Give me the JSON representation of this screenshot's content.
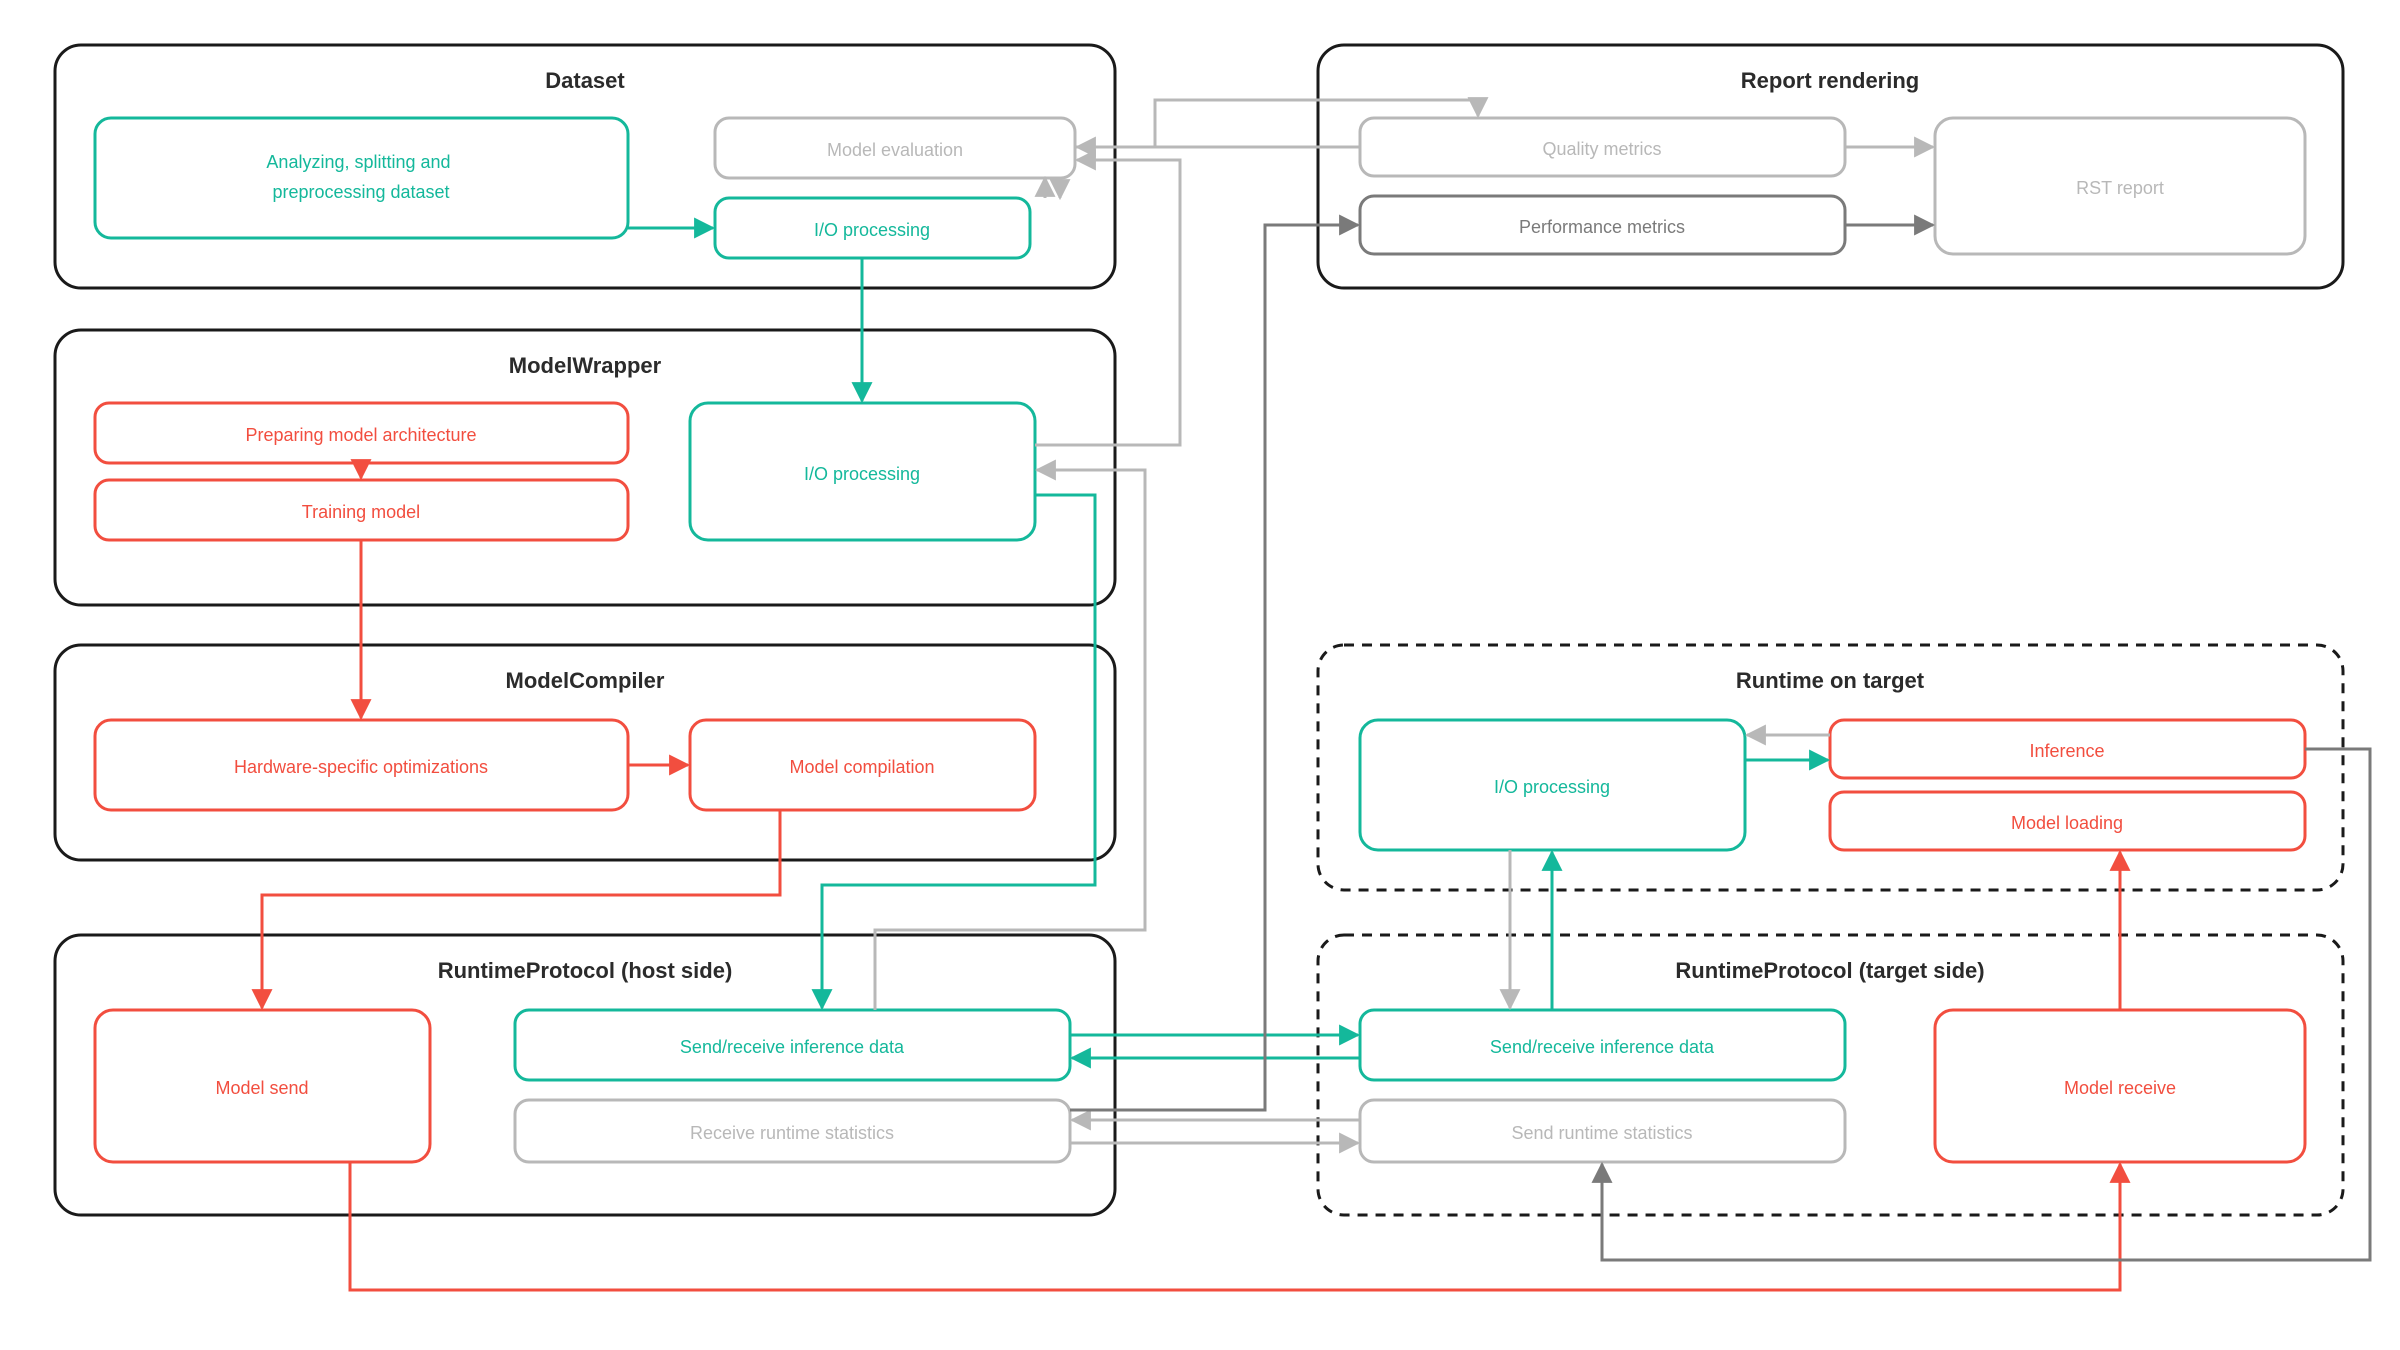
{
  "colors": {
    "black": "#1a1a1a",
    "teal": "#14b89b",
    "red": "#f24e3f",
    "gray": "#b8b8b8",
    "darkgray": "#7a7a7a",
    "bg": "#ffffff"
  },
  "groups": {
    "dataset": {
      "title": "Dataset",
      "nodes": {
        "analyze": "Analyzing, splitting and\npreprocessing dataset",
        "model_eval": "Model evaluation",
        "io_processing": "I/O processing"
      }
    },
    "model_wrapper": {
      "title": "ModelWrapper",
      "nodes": {
        "prepare_arch": "Preparing model architecture",
        "training": "Training model",
        "io_processing": "I/O processing"
      }
    },
    "model_compiler": {
      "title": "ModelCompiler",
      "nodes": {
        "hw_opt": "Hardware-specific optimizations",
        "compilation": "Model compilation"
      }
    },
    "runtime_protocol_host": {
      "title": "RuntimeProtocol (host side)",
      "nodes": {
        "model_send": "Model send",
        "send_recv_inf": "Send/receive inference data",
        "recv_stats": "Receive runtime statistics"
      }
    },
    "report_rendering": {
      "title": "Report rendering",
      "nodes": {
        "quality": "Quality metrics",
        "performance": "Performance metrics",
        "rst_report": "RST report"
      }
    },
    "runtime_on_target": {
      "title": "Runtime on target",
      "nodes": {
        "io_processing": "I/O processing",
        "inference": "Inference",
        "model_loading": "Model loading"
      }
    },
    "runtime_protocol_target": {
      "title": "RuntimeProtocol (target side)",
      "nodes": {
        "send_recv_inf": "Send/receive inference data",
        "send_stats": "Send runtime statistics",
        "model_receive": "Model receive"
      }
    }
  },
  "connections_note": "Arrows connect: Dataset.analyze → Dataset.io_processing → ModelWrapper.io_processing → RPHost.send_recv_inf ↔ RPTarget.send_recv_inf → RuntimeOnTarget.io_processing ↔ Inference. ModelWrapper.prepare_arch → training → ModelCompiler.hw_opt → compilation → RPHost.model_send → RPTarget.model_receive → RuntimeOnTarget.model_loading. Dataset.model_eval ↔ ReportRendering.quality → rst_report. RPHost.recv_stats ↔ RPTarget.send_stats → ReportRendering.performance → rst_report. Inference → send_stats."
}
